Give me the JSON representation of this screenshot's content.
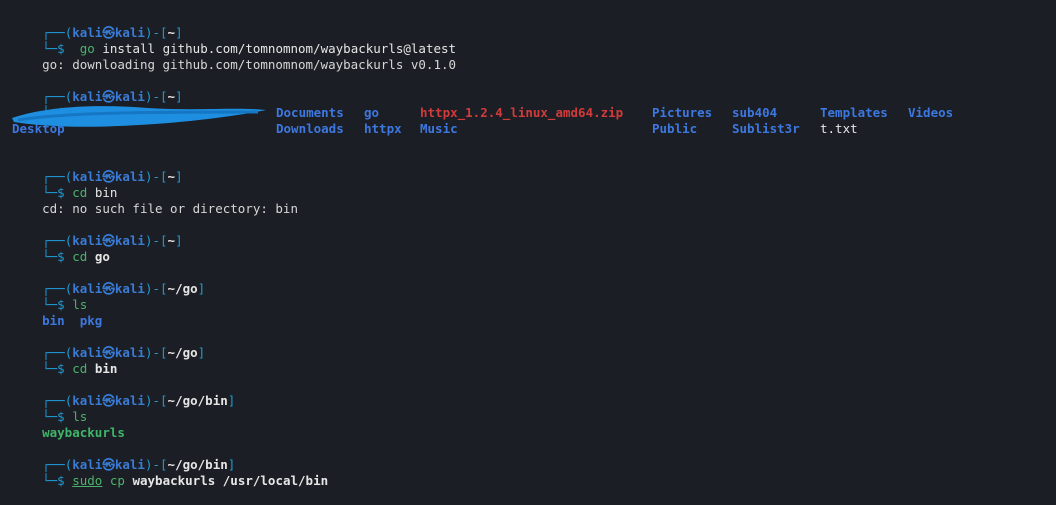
{
  "prompt": {
    "user": "kali",
    "host": "kali",
    "at_symbol": "㉿",
    "open": "(",
    "close": ")",
    "dash": "-",
    "lb": "[",
    "rb": "]",
    "top_prefix": "┌──",
    "bottom_prefix": "└─",
    "dollar": "$"
  },
  "blocks": [
    {
      "dir": "~",
      "cmd": "go",
      "args": "install github.com/tomnomnom/waybackurls@latest"
    },
    {
      "output": "go: downloading github.com/tomnomnom/waybackurls v0.1.0"
    },
    {
      "dir": "~",
      "cmd": "ls"
    },
    {
      "dir": "~",
      "cmd": "cd",
      "args": "bin",
      "error": "cd: no such file or directory: bin"
    },
    {
      "dir": "~",
      "cmd": "cd",
      "args": "go"
    },
    {
      "dir": "~/go",
      "cmd": "ls",
      "output_items": [
        "bin",
        "pkg"
      ]
    },
    {
      "dir": "~/go",
      "cmd": "cd",
      "args": "bin"
    },
    {
      "dir": "~/go/bin",
      "cmd": "ls",
      "output_items": [
        "waybackurls"
      ]
    },
    {
      "dir": "~/go/bin",
      "cmd": "sudo",
      "cmd2": "cp",
      "args": "waybackurls /usr/local/bin"
    }
  ],
  "ls_home": {
    "row1": [
      "Documents",
      "go",
      "httpx_1.2.4_linux_amd64.zip",
      "Pictures",
      "sub404",
      "Templates",
      "Videos"
    ],
    "row2": [
      "Desktop",
      "Downloads",
      "httpx",
      "Music",
      "Public",
      "Sublist3r",
      "t.txt"
    ]
  },
  "colors": {
    "background": "#1b1e24",
    "prompt_frame": "#1e9ad6",
    "user_host": "#3a7bd5",
    "command": "#4cb26b",
    "directory_listing": "#3d78e0",
    "archive_file": "#d23b3b",
    "scribble": "#1e8fe0"
  }
}
